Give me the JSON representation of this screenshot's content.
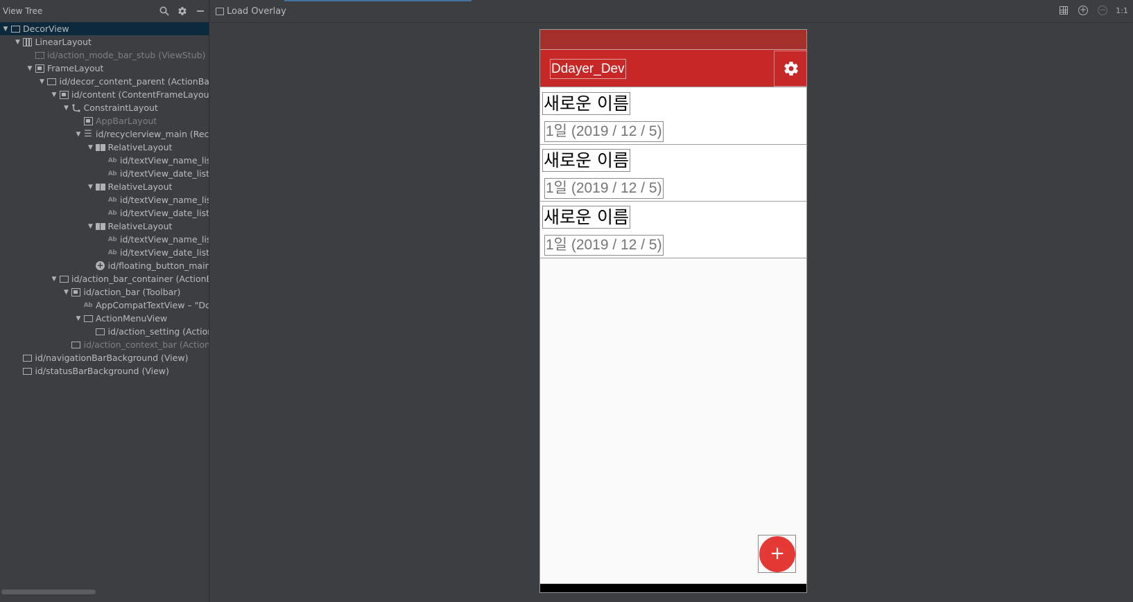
{
  "left_panel": {
    "title": "View Tree",
    "tree": [
      {
        "label": "DecorView",
        "depth": 0,
        "arrow": true,
        "icon": "box-icon",
        "selected": true,
        "dim": false
      },
      {
        "label": "LinearLayout",
        "depth": 1,
        "arrow": true,
        "icon": "linear-layout-icon",
        "selected": false,
        "dim": false
      },
      {
        "label": "id/action_mode_bar_stub (ViewStub)",
        "depth": 2,
        "arrow": false,
        "icon": "viewstub-icon",
        "selected": false,
        "dim": true
      },
      {
        "label": "FrameLayout",
        "depth": 2,
        "arrow": true,
        "icon": "frame-layout-icon",
        "selected": false,
        "dim": false
      },
      {
        "label": "id/decor_content_parent (ActionBarOverlayLayout)",
        "depth": 3,
        "arrow": true,
        "icon": "box-icon",
        "selected": false,
        "dim": false
      },
      {
        "label": "id/content (ContentFrameLayout)",
        "depth": 4,
        "arrow": true,
        "icon": "frame-layout-icon",
        "selected": false,
        "dim": false
      },
      {
        "label": "ConstraintLayout",
        "depth": 5,
        "arrow": true,
        "icon": "constraint-layout-icon",
        "selected": false,
        "dim": false
      },
      {
        "label": "AppBarLayout",
        "depth": 6,
        "arrow": false,
        "icon": "appbar-icon",
        "selected": false,
        "dim": true
      },
      {
        "label": "id/recyclerview_main (RecyclerView)",
        "depth": 6,
        "arrow": true,
        "icon": "list-icon",
        "selected": false,
        "dim": false
      },
      {
        "label": "RelativeLayout",
        "depth": 7,
        "arrow": true,
        "icon": "relative-layout-icon",
        "selected": false,
        "dim": false
      },
      {
        "label": "id/textView_name_list",
        "depth": 8,
        "arrow": false,
        "icon": "textview-icon",
        "selected": false,
        "dim": false
      },
      {
        "label": "id/textView_date_list",
        "depth": 8,
        "arrow": false,
        "icon": "textview-icon",
        "selected": false,
        "dim": false
      },
      {
        "label": "RelativeLayout",
        "depth": 7,
        "arrow": true,
        "icon": "relative-layout-icon",
        "selected": false,
        "dim": false
      },
      {
        "label": "id/textView_name_list",
        "depth": 8,
        "arrow": false,
        "icon": "textview-icon",
        "selected": false,
        "dim": false
      },
      {
        "label": "id/textView_date_list",
        "depth": 8,
        "arrow": false,
        "icon": "textview-icon",
        "selected": false,
        "dim": false
      },
      {
        "label": "RelativeLayout",
        "depth": 7,
        "arrow": true,
        "icon": "relative-layout-icon",
        "selected": false,
        "dim": false
      },
      {
        "label": "id/textView_name_list",
        "depth": 8,
        "arrow": false,
        "icon": "textview-icon",
        "selected": false,
        "dim": false
      },
      {
        "label": "id/textView_date_list",
        "depth": 8,
        "arrow": false,
        "icon": "textview-icon",
        "selected": false,
        "dim": false
      },
      {
        "label": "id/floating_button_main (FloatingActionButton)",
        "depth": 7,
        "arrow": false,
        "icon": "fab-icon",
        "selected": false,
        "dim": false
      },
      {
        "label": "id/action_bar_container (ActionBarContainer)",
        "depth": 4,
        "arrow": true,
        "icon": "box-icon",
        "selected": false,
        "dim": false
      },
      {
        "label": "id/action_bar (Toolbar)",
        "depth": 5,
        "arrow": true,
        "icon": "toolbar-icon",
        "selected": false,
        "dim": false
      },
      {
        "label": "AppCompatTextView – \"Ddayer_Dev\"",
        "depth": 6,
        "arrow": false,
        "icon": "textview-icon",
        "selected": false,
        "dim": false
      },
      {
        "label": "ActionMenuView",
        "depth": 6,
        "arrow": true,
        "icon": "box-icon",
        "selected": false,
        "dim": false
      },
      {
        "label": "id/action_setting (ActionMenuItemView)",
        "depth": 7,
        "arrow": false,
        "icon": "box-icon",
        "selected": false,
        "dim": false
      },
      {
        "label": "id/action_context_bar (ActionBarContextView)",
        "depth": 5,
        "arrow": false,
        "icon": "box-icon",
        "selected": false,
        "dim": true
      },
      {
        "label": "id/navigationBarBackground (View)",
        "depth": 1,
        "arrow": false,
        "icon": "box-icon",
        "selected": false,
        "dim": false
      },
      {
        "label": "id/statusBarBackground (View)",
        "depth": 1,
        "arrow": false,
        "icon": "box-icon",
        "selected": false,
        "dim": false
      }
    ]
  },
  "right_header": {
    "load_overlay_label": "Load Overlay",
    "zoom_actual_label": "1:1"
  },
  "device": {
    "app_title": "Ddayer_Dev",
    "items": [
      {
        "name": "새로운 이름",
        "date": "1일 (2019 / 12 / 5)"
      },
      {
        "name": "새로운 이름",
        "date": "1일 (2019 / 12 / 5)"
      },
      {
        "name": "새로운 이름",
        "date": "1일 (2019 / 12 / 5)"
      }
    ],
    "fab_symbol": "+"
  },
  "colors": {
    "ide_background": "#3c3f41",
    "status_bar": "#a52f2b",
    "app_bar": "#c62828",
    "fab": "#e53935",
    "selection": "#0d293e"
  }
}
